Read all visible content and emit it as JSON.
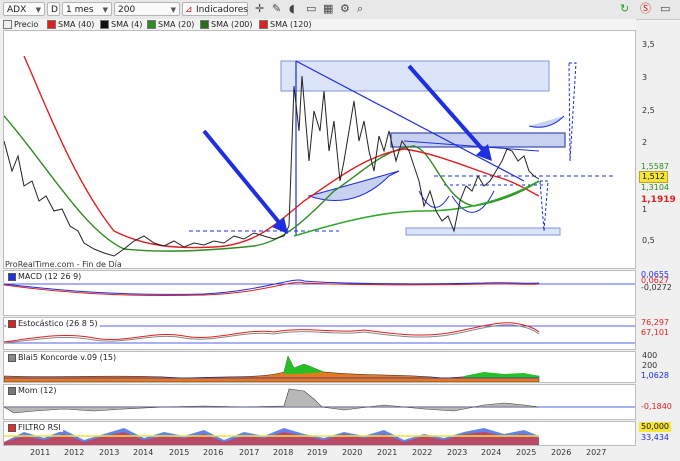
{
  "toolbar": {
    "symbol": "ADX",
    "type_letter": "D",
    "timeframe": "1 mes",
    "units": "200 unidades",
    "indicators": "Indicadores",
    "app_icon": "prorealtime-logo-icon",
    "refresh_icon": "refresh-icon"
  },
  "legend": {
    "items": [
      {
        "label": "Precio",
        "color": "#e8e8e8"
      },
      {
        "label": "SMA (40)",
        "color": "#e02020"
      },
      {
        "label": "SMA (4)",
        "color": "#111111"
      },
      {
        "label": "SMA (20)",
        "color": "#2e8b22"
      },
      {
        "label": "SMA (200)",
        "color": "#2a6a1a"
      },
      {
        "label": "SMA (120)",
        "color": "#e02020"
      }
    ]
  },
  "price_axis": {
    "ticks": [
      "3,5",
      "3",
      "2,5",
      "2",
      "1,5",
      "1",
      "0,5"
    ],
    "last_price": "1,512",
    "tag_upper": "1,5587",
    "tag_green": "1,3104",
    "tag_red": "1,1919"
  },
  "watermark": "ProRealTime.com - Fin de Día",
  "panes": {
    "macd": {
      "title": "MACD (12 26 9)",
      "values": [
        "0,0655",
        "0,0627",
        "-0,0272"
      ]
    },
    "stoch": {
      "title": "Estocástico (26 8 5)",
      "values": [
        "76,297",
        "67,101"
      ]
    },
    "blai5": {
      "title": "Blai5 Koncorde v.09 (15)",
      "ticks": [
        "400",
        "200"
      ],
      "values": [
        "1,0628"
      ]
    },
    "mom": {
      "title": "Mom (12)",
      "values": [
        "-0,1840"
      ]
    },
    "rsi": {
      "title": "FILTRO RSI",
      "ticks": [
        "50,000",
        "33,434"
      ]
    }
  },
  "years": [
    "2011",
    "2012",
    "2013",
    "2014",
    "2015",
    "2016",
    "2017",
    "2018",
    "2019",
    "2020",
    "2021",
    "2022",
    "2023",
    "2024",
    "2025",
    "2026",
    "2027"
  ],
  "colors": {
    "sma_red": "#e02020",
    "sma_green": "#2e8b22",
    "blue_arrow": "#1e2ee0",
    "band": "#c8d4f4"
  }
}
